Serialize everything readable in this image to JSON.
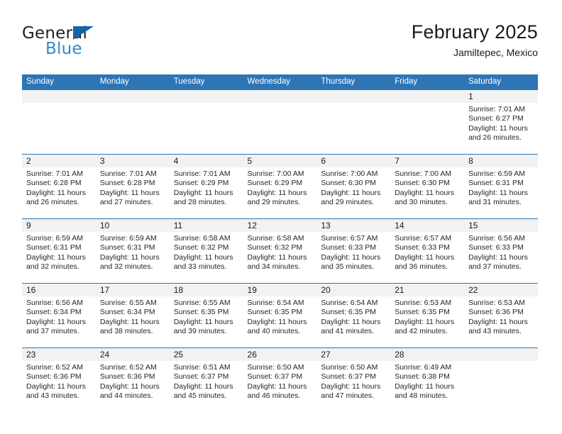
{
  "logo": {
    "word_top": "General",
    "word_bottom": "Blue",
    "triangle_color": "#1464aa",
    "blue_color": "#2e8bd0"
  },
  "header": {
    "title": "February 2025",
    "subtitle": "Jamiltepec, Mexico"
  },
  "theme": {
    "header_bg": "#2e75b6",
    "header_text": "#ffffff",
    "daynum_bg": "#f2f2f2",
    "row_border": "#2e75b6"
  },
  "calendar": {
    "weekday_headers": [
      "Sunday",
      "Monday",
      "Tuesday",
      "Wednesday",
      "Thursday",
      "Friday",
      "Saturday"
    ],
    "weeks": [
      [
        {
          "day": "",
          "empty": true
        },
        {
          "day": "",
          "empty": true
        },
        {
          "day": "",
          "empty": true
        },
        {
          "day": "",
          "empty": true
        },
        {
          "day": "",
          "empty": true
        },
        {
          "day": "",
          "empty": true
        },
        {
          "day": "1",
          "sunrise": "Sunrise: 7:01 AM",
          "sunset": "Sunset: 6:27 PM",
          "daylight": "Daylight: 11 hours and 26 minutes."
        }
      ],
      [
        {
          "day": "2",
          "sunrise": "Sunrise: 7:01 AM",
          "sunset": "Sunset: 6:28 PM",
          "daylight": "Daylight: 11 hours and 26 minutes."
        },
        {
          "day": "3",
          "sunrise": "Sunrise: 7:01 AM",
          "sunset": "Sunset: 6:28 PM",
          "daylight": "Daylight: 11 hours and 27 minutes."
        },
        {
          "day": "4",
          "sunrise": "Sunrise: 7:01 AM",
          "sunset": "Sunset: 6:29 PM",
          "daylight": "Daylight: 11 hours and 28 minutes."
        },
        {
          "day": "5",
          "sunrise": "Sunrise: 7:00 AM",
          "sunset": "Sunset: 6:29 PM",
          "daylight": "Daylight: 11 hours and 29 minutes."
        },
        {
          "day": "6",
          "sunrise": "Sunrise: 7:00 AM",
          "sunset": "Sunset: 6:30 PM",
          "daylight": "Daylight: 11 hours and 29 minutes."
        },
        {
          "day": "7",
          "sunrise": "Sunrise: 7:00 AM",
          "sunset": "Sunset: 6:30 PM",
          "daylight": "Daylight: 11 hours and 30 minutes."
        },
        {
          "day": "8",
          "sunrise": "Sunrise: 6:59 AM",
          "sunset": "Sunset: 6:31 PM",
          "daylight": "Daylight: 11 hours and 31 minutes."
        }
      ],
      [
        {
          "day": "9",
          "sunrise": "Sunrise: 6:59 AM",
          "sunset": "Sunset: 6:31 PM",
          "daylight": "Daylight: 11 hours and 32 minutes."
        },
        {
          "day": "10",
          "sunrise": "Sunrise: 6:59 AM",
          "sunset": "Sunset: 6:31 PM",
          "daylight": "Daylight: 11 hours and 32 minutes."
        },
        {
          "day": "11",
          "sunrise": "Sunrise: 6:58 AM",
          "sunset": "Sunset: 6:32 PM",
          "daylight": "Daylight: 11 hours and 33 minutes."
        },
        {
          "day": "12",
          "sunrise": "Sunrise: 6:58 AM",
          "sunset": "Sunset: 6:32 PM",
          "daylight": "Daylight: 11 hours and 34 minutes."
        },
        {
          "day": "13",
          "sunrise": "Sunrise: 6:57 AM",
          "sunset": "Sunset: 6:33 PM",
          "daylight": "Daylight: 11 hours and 35 minutes."
        },
        {
          "day": "14",
          "sunrise": "Sunrise: 6:57 AM",
          "sunset": "Sunset: 6:33 PM",
          "daylight": "Daylight: 11 hours and 36 minutes."
        },
        {
          "day": "15",
          "sunrise": "Sunrise: 6:56 AM",
          "sunset": "Sunset: 6:33 PM",
          "daylight": "Daylight: 11 hours and 37 minutes."
        }
      ],
      [
        {
          "day": "16",
          "sunrise": "Sunrise: 6:56 AM",
          "sunset": "Sunset: 6:34 PM",
          "daylight": "Daylight: 11 hours and 37 minutes."
        },
        {
          "day": "17",
          "sunrise": "Sunrise: 6:55 AM",
          "sunset": "Sunset: 6:34 PM",
          "daylight": "Daylight: 11 hours and 38 minutes."
        },
        {
          "day": "18",
          "sunrise": "Sunrise: 6:55 AM",
          "sunset": "Sunset: 6:35 PM",
          "daylight": "Daylight: 11 hours and 39 minutes."
        },
        {
          "day": "19",
          "sunrise": "Sunrise: 6:54 AM",
          "sunset": "Sunset: 6:35 PM",
          "daylight": "Daylight: 11 hours and 40 minutes."
        },
        {
          "day": "20",
          "sunrise": "Sunrise: 6:54 AM",
          "sunset": "Sunset: 6:35 PM",
          "daylight": "Daylight: 11 hours and 41 minutes."
        },
        {
          "day": "21",
          "sunrise": "Sunrise: 6:53 AM",
          "sunset": "Sunset: 6:35 PM",
          "daylight": "Daylight: 11 hours and 42 minutes."
        },
        {
          "day": "22",
          "sunrise": "Sunrise: 6:53 AM",
          "sunset": "Sunset: 6:36 PM",
          "daylight": "Daylight: 11 hours and 43 minutes."
        }
      ],
      [
        {
          "day": "23",
          "sunrise": "Sunrise: 6:52 AM",
          "sunset": "Sunset: 6:36 PM",
          "daylight": "Daylight: 11 hours and 43 minutes."
        },
        {
          "day": "24",
          "sunrise": "Sunrise: 6:52 AM",
          "sunset": "Sunset: 6:36 PM",
          "daylight": "Daylight: 11 hours and 44 minutes."
        },
        {
          "day": "25",
          "sunrise": "Sunrise: 6:51 AM",
          "sunset": "Sunset: 6:37 PM",
          "daylight": "Daylight: 11 hours and 45 minutes."
        },
        {
          "day": "26",
          "sunrise": "Sunrise: 6:50 AM",
          "sunset": "Sunset: 6:37 PM",
          "daylight": "Daylight: 11 hours and 46 minutes."
        },
        {
          "day": "27",
          "sunrise": "Sunrise: 6:50 AM",
          "sunset": "Sunset: 6:37 PM",
          "daylight": "Daylight: 11 hours and 47 minutes."
        },
        {
          "day": "28",
          "sunrise": "Sunrise: 6:49 AM",
          "sunset": "Sunset: 6:38 PM",
          "daylight": "Daylight: 11 hours and 48 minutes."
        },
        {
          "day": "",
          "empty": true
        }
      ]
    ]
  }
}
